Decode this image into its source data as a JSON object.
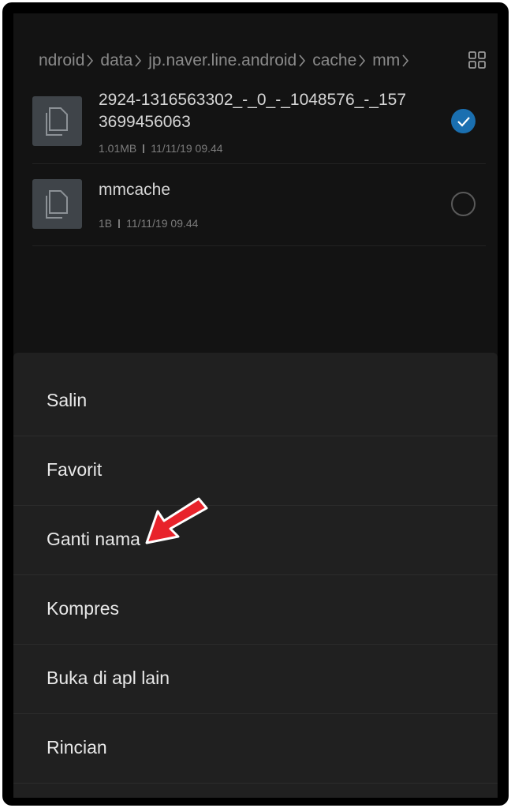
{
  "breadcrumb": [
    "ndroid",
    "data",
    "jp.naver.line.android",
    "cache",
    "mm"
  ],
  "icons": {
    "grid_view": "grid-icon",
    "file": "file-copy-icon",
    "check": "check-icon",
    "annotation_arrow": "red-arrow-icon"
  },
  "files": [
    {
      "name": "2924-1316563302_-_0_-_1048576_-_1573699456063",
      "size": "1.01MB",
      "date": "11/11/19 09.44",
      "selected": true
    },
    {
      "name": "mmcache",
      "size": "1B",
      "date": "11/11/19 09.44",
      "selected": false
    }
  ],
  "menu": [
    "Salin",
    "Favorit",
    "Ganti nama",
    "Kompres",
    "Buka di apl lain",
    "Rincian"
  ],
  "colors": {
    "accent": "#1a6fb0",
    "annotation": "#e8232b"
  }
}
